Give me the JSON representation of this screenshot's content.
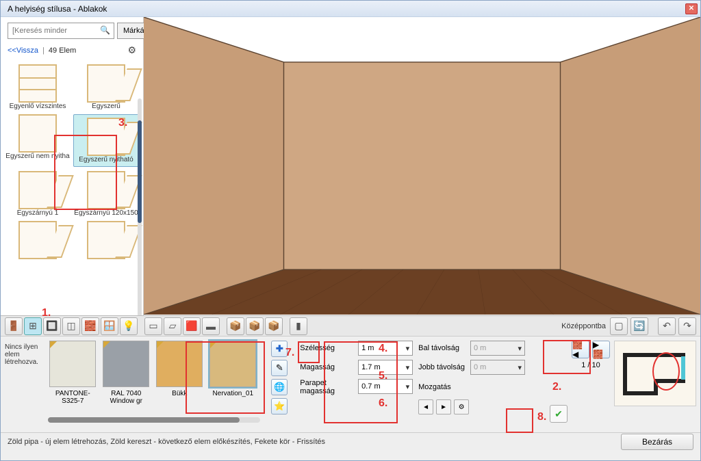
{
  "window": {
    "title": "A helyiség stílusa - Ablakok"
  },
  "search": {
    "placeholder": "[Keresés minder",
    "brands": "Márkák"
  },
  "back": {
    "label": "<<Vissza",
    "count_label": "49 Elem"
  },
  "catalog": [
    {
      "label": "Egyenlő vízszintes"
    },
    {
      "label": "Egyszerű"
    },
    {
      "label": "Egyszerű nem nyitha"
    },
    {
      "label": "Egyszerű nyitható",
      "selected": true
    },
    {
      "label": "Egyszárnyú 1"
    },
    {
      "label": "Egyszárnyú 120x150"
    },
    {
      "label": ""
    },
    {
      "label": ""
    }
  ],
  "center_label": "Középpontba",
  "no_elem": "Nincs ilyen elem létrehozva.",
  "materials": [
    {
      "label": "PANTONE-S325-7",
      "color": "#e6e5da"
    },
    {
      "label": "RAL 7040 Window gr",
      "color": "#9aa0a7"
    },
    {
      "label": "Bükk",
      "color": "#e0ae5f"
    },
    {
      "label": "Nervation_01",
      "color": "#d8b97d",
      "selected": true
    }
  ],
  "params": {
    "width_label": "Szélesség",
    "width_value": "1 m",
    "height_label": "Magasság",
    "height_value": "1.7 m",
    "parapet_label": "Parapet magasság",
    "parapet_value": "0.7 m",
    "left_label": "Bal távolság",
    "left_value": "0 m",
    "right_label": "Jobb távolság",
    "right_value": "0 m",
    "move_label": "Mozgatás"
  },
  "wallnav": {
    "counter": "1 / 10"
  },
  "status": "Zöld pipa - új elem létrehozás, Zöld kereszt - következő elem előkészítés, Fekete kör - Frissítés",
  "close": "Bezárás",
  "annotations": {
    "n1": "1.",
    "n2": "2.",
    "n3": "3.",
    "n4": "4.",
    "n5": "5.",
    "n6": "6.",
    "n7": "7.",
    "n8": "8."
  }
}
